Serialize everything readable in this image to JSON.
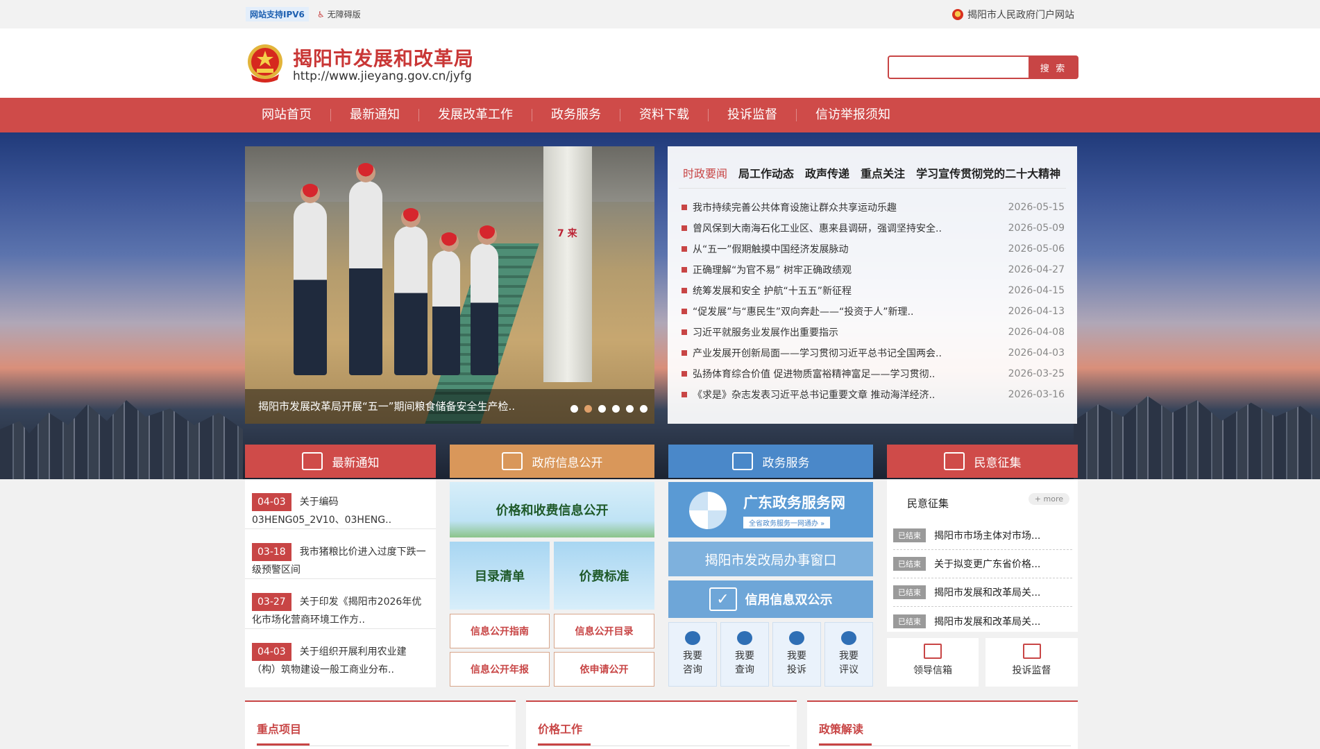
{
  "topbar": {
    "ipv6": "网站支持IPV6",
    "accessible": "无障碍版",
    "portal": "揭阳市人民政府门户网站"
  },
  "header": {
    "title": "揭阳市发展和改革局",
    "url": "http://www.jieyang.gov.cn/jyfg"
  },
  "search": {
    "placeholder": "",
    "button": "搜 索"
  },
  "nav": [
    "网站首页",
    "最新通知",
    "发展改革工作",
    "政务服务",
    "资料下载",
    "投诉监督",
    "信访举报须知"
  ],
  "slider": {
    "caption": "揭阳市发展改革局开展“五一”期间粮食储备安全生产检..",
    "pillar_label": "7 来",
    "slide_count": 6,
    "active_dot": 1
  },
  "news": {
    "tabs": [
      "时政要闻",
      "局工作动态",
      "政声传递",
      "重点关注",
      "学习宣传贯彻党的二十大精神"
    ],
    "items": [
      {
        "title": "我市持续完善公共体育设施让群众共享运动乐趣",
        "date": "2026-05-15"
      },
      {
        "title": "曾风保到大南海石化工业区、惠来县调研，强调坚持安全..",
        "date": "2026-05-09"
      },
      {
        "title": "从“五一”假期触摸中国经济发展脉动",
        "date": "2026-05-06"
      },
      {
        "title": "正确理解“为官不易” 树牢正确政绩观",
        "date": "2026-04-27"
      },
      {
        "title": "统筹发展和安全 护航“十五五”新征程",
        "date": "2026-04-15"
      },
      {
        "title": "“促发展”与“惠民生”双向奔赴——“投资于人”新理..",
        "date": "2026-04-13"
      },
      {
        "title": "习近平就服务业发展作出重要指示",
        "date": "2026-04-08"
      },
      {
        "title": "产业发展开创新局面——学习贯彻习近平总书记全国两会..",
        "date": "2026-04-03"
      },
      {
        "title": "弘扬体育综合价值 促进物质富裕精神富足——学习贯彻..",
        "date": "2026-03-25"
      },
      {
        "title": "《求是》杂志发表习近平总书记重要文章 推动海洋经济..",
        "date": "2026-03-16"
      }
    ]
  },
  "sections": {
    "notice": "最新通知",
    "gov_info": "政府信息公开",
    "gov_service": "政务服务",
    "opinion": "民意征集"
  },
  "notices": [
    {
      "tag": "04-03",
      "text": "关于编码03HENG05_2V10、03HENG.."
    },
    {
      "tag": "03-18",
      "text": "我市猪粮比价进入过度下跌一级预警区间"
    },
    {
      "tag": "03-27",
      "text": "关于印发《揭阳市2026年优化市场化营商环境工作方.."
    },
    {
      "tag": "04-03",
      "text": "关于组织开展利用农业建（构）筑物建设一般工商业分布.."
    }
  ],
  "gov_info": {
    "price_banner": "价格和收费信息公开",
    "catalog": "目录清单",
    "price_std": "价费标准",
    "links": [
      "信息公开指南",
      "信息公开目录",
      "信息公开年报",
      "依申请公开"
    ]
  },
  "gov_service": {
    "gd_title": "广东政务服务网",
    "gd_sub": "全省政务服务一网通办 »",
    "window": "揭阳市发改局办事窗口",
    "credit": "信用信息双公示",
    "buttons": [
      "我要咨询",
      "我要查询",
      "我要投诉",
      "我要评议"
    ]
  },
  "opinion": {
    "title": "民意征集",
    "more": "+ more",
    "items": [
      {
        "status": "已结束",
        "text": "揭阳市市场主体对市场..."
      },
      {
        "status": "已结束",
        "text": "关于拟变更广东省价格..."
      },
      {
        "status": "已结束",
        "text": "揭阳市发展和改革局关..."
      },
      {
        "status": "已结束",
        "text": "揭阳市发展和改革局关..."
      }
    ],
    "leader_mail": "领导信箱",
    "complaint": "投诉监督"
  },
  "bottom": [
    "重点项目",
    "价格工作",
    "政策解读"
  ],
  "colors": {
    "brand_red": "#cf4b49",
    "orange": "#d9975a",
    "blue": "#4a88c9"
  }
}
